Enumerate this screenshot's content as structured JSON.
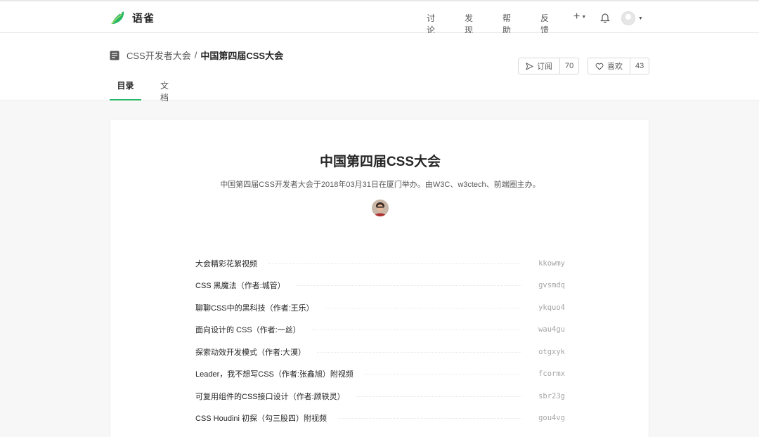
{
  "nav": {
    "brand": "语雀",
    "links": [
      "讨论",
      "发现",
      "帮助",
      "反馈"
    ],
    "plus_label": "+"
  },
  "book": {
    "group": "CSS开发者大会",
    "separator": "/",
    "name": "中国第四届CSS大会",
    "subscribe": {
      "label": "订阅",
      "count": "70"
    },
    "like": {
      "label": "喜欢",
      "count": "43"
    },
    "tabs": [
      "目录",
      "文档"
    ]
  },
  "main": {
    "title": "中国第四届CSS大会",
    "description": "中国第四届CSS开发者大会于2018年03月31日在厦门举办。由W3C、w3ctech、前端圈主办。",
    "toc": [
      {
        "title": "大会精彩花絮视频",
        "slug": "kkowmy"
      },
      {
        "title": "CSS 黑魔法（作者:城管）",
        "slug": "gvsmdq"
      },
      {
        "title": "聊聊CSS中的黑科技（作者:王乐）",
        "slug": "ykquo4"
      },
      {
        "title": "面向设计的 CSS（作者:一丝）",
        "slug": "wau4gu"
      },
      {
        "title": "探索动效开发模式（作者:大漠）",
        "slug": "otgxyk"
      },
      {
        "title": "Leader，我不想写CSS（作者:张鑫旭）附视频",
        "slug": "fcormx"
      },
      {
        "title": "可复用组件的CSS接口设计（作者:顾轶灵）",
        "slug": "sbr23g"
      },
      {
        "title": "CSS Houdini 初探（勾三股四）附视频",
        "slug": "gou4vg"
      }
    ]
  },
  "colors": {
    "accent": "#25b864",
    "text": "#262626",
    "muted": "#595959",
    "slug": "#a6a6a6"
  }
}
